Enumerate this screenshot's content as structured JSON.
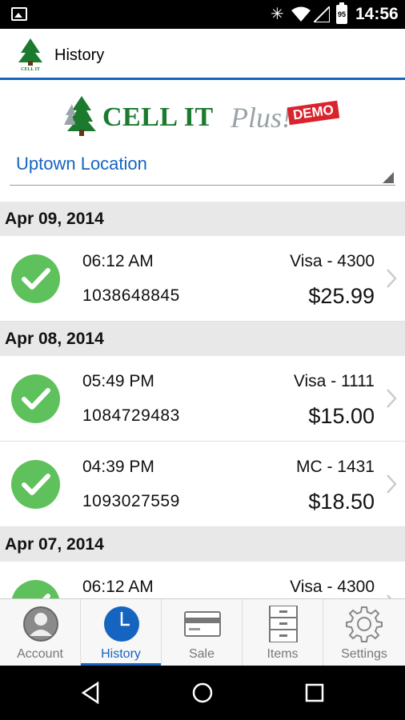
{
  "status_bar": {
    "battery_level": "95",
    "time": "14:56",
    "icons": [
      "image-icon",
      "bluetooth-icon",
      "wifi-icon",
      "signal-icon",
      "battery-icon"
    ]
  },
  "app_bar": {
    "title": "History",
    "logo_text": "CELL IT Plus!"
  },
  "brand": {
    "name": "CELL IT",
    "plus": "Plus!",
    "badge": "DEMO",
    "colors": {
      "green": "#1b7a2e",
      "grey": "#9aa4a8",
      "red": "#d9232d"
    }
  },
  "location": {
    "selected": "Uptown Location"
  },
  "history": {
    "groups": [
      {
        "date": "Apr 09, 2014",
        "transactions": [
          {
            "time": "06:12 AM",
            "id": "1038648845",
            "card": "Visa - 4300",
            "amount": "$25.99",
            "status": "approved"
          }
        ]
      },
      {
        "date": "Apr 08, 2014",
        "transactions": [
          {
            "time": "05:49 PM",
            "id": "1084729483",
            "card": "Visa - 1111",
            "amount": "$15.00",
            "status": "approved"
          },
          {
            "time": "04:39 PM",
            "id": "1093027559",
            "card": "MC - 1431",
            "amount": "$18.50",
            "status": "approved"
          }
        ]
      },
      {
        "date": "Apr 07, 2014",
        "transactions": [
          {
            "time": "06:12 AM",
            "id": "",
            "card": "Visa - 4300",
            "amount": "",
            "status": "refund"
          }
        ]
      }
    ]
  },
  "bottom_nav": {
    "items": [
      {
        "label": "Account",
        "icon": "account-icon",
        "active": false
      },
      {
        "label": "History",
        "icon": "clock-icon",
        "active": true
      },
      {
        "label": "Sale",
        "icon": "credit-card-icon",
        "active": false
      },
      {
        "label": "Items",
        "icon": "cabinet-icon",
        "active": false
      },
      {
        "label": "Settings",
        "icon": "gear-icon",
        "active": false
      }
    ]
  },
  "colors": {
    "accent": "#1565c0",
    "success": "#5ec15c",
    "header_bg": "#e8e8e8"
  }
}
